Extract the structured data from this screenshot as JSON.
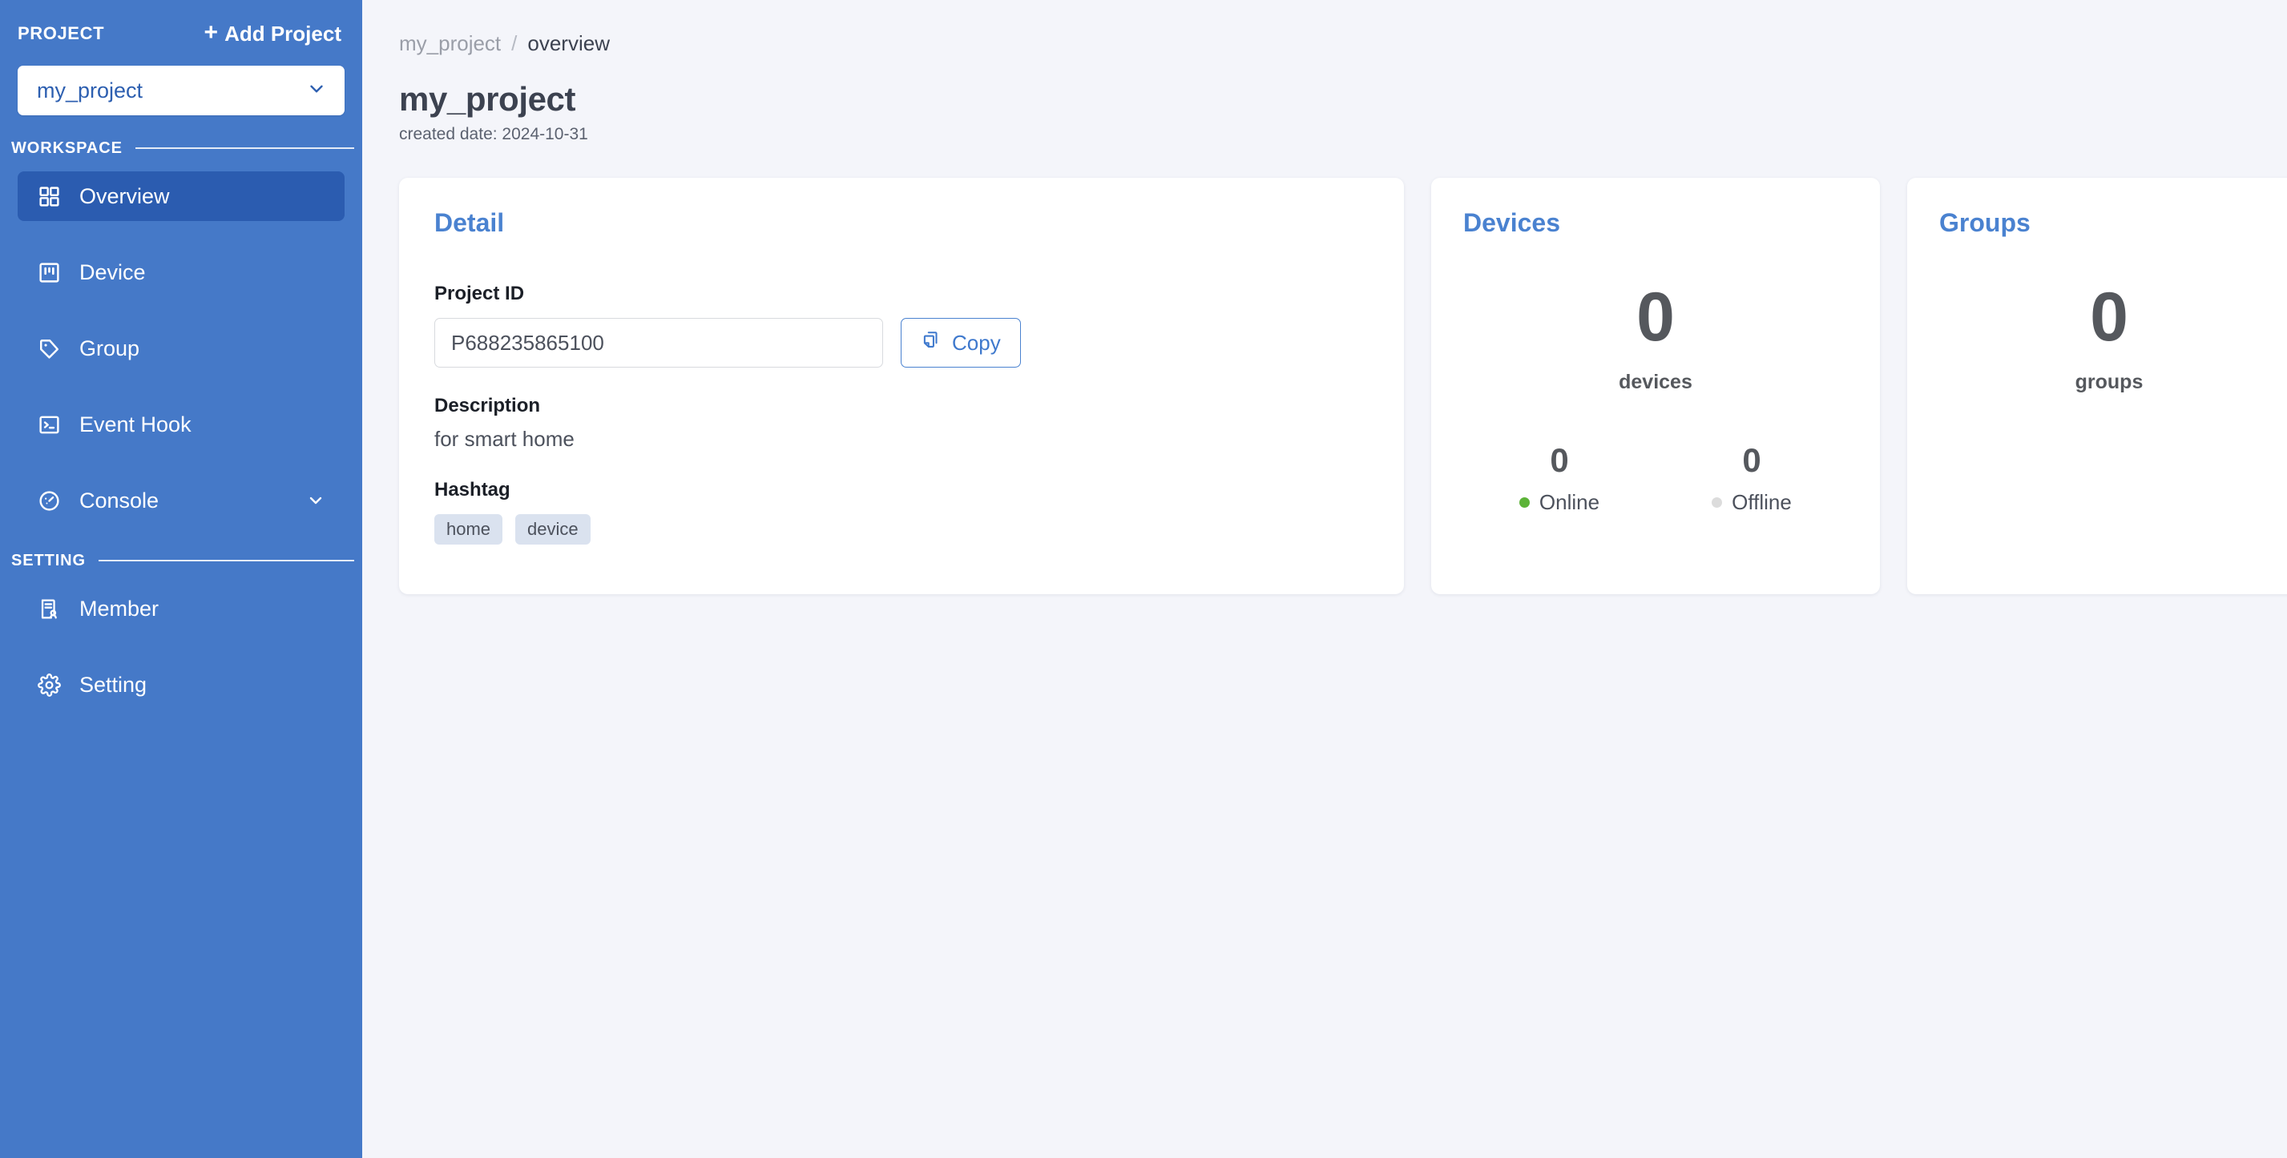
{
  "sidebar": {
    "project_label": "PROJECT",
    "add_project_label": "Add Project",
    "add_plus": "+",
    "selected_project": "my_project",
    "workspace_label": "WORKSPACE",
    "setting_label": "SETTING",
    "workspace_items": [
      {
        "label": "Overview",
        "icon": "grid-icon",
        "active": true
      },
      {
        "label": "Device",
        "icon": "device-icon",
        "active": false
      },
      {
        "label": "Group",
        "icon": "tag-icon",
        "active": false
      },
      {
        "label": "Event Hook",
        "icon": "terminal-icon",
        "active": false
      },
      {
        "label": "Console",
        "icon": "gauge-icon",
        "active": false,
        "expandable": true
      }
    ],
    "setting_items": [
      {
        "label": "Member",
        "icon": "member-icon",
        "active": false
      },
      {
        "label": "Setting",
        "icon": "gear-icon",
        "active": false
      }
    ]
  },
  "breadcrumb": {
    "parent": "my_project",
    "separator": "/",
    "current": "overview"
  },
  "header": {
    "title": "my_project",
    "subtitle": "created date: 2024-10-31"
  },
  "detail_card": {
    "title": "Detail",
    "project_id_label": "Project ID",
    "project_id_value": "P688235865100",
    "copy_label": "Copy",
    "description_label": "Description",
    "description_value": "for smart home",
    "hashtag_label": "Hashtag",
    "hashtags": [
      "home",
      "device"
    ]
  },
  "devices_card": {
    "title": "Devices",
    "count": "0",
    "unit": "devices",
    "online_count": "0",
    "online_label": "Online",
    "offline_count": "0",
    "offline_label": "Offline"
  },
  "groups_card": {
    "title": "Groups",
    "count": "0",
    "unit": "groups"
  },
  "colors": {
    "sidebar_blue": "#4579c8",
    "active_blue": "#2b5cb0",
    "accent_blue": "#4a82d0",
    "online_green": "#5cb338",
    "offline_gray": "#dcdcdc",
    "page_bg": "#f4f5fa"
  }
}
